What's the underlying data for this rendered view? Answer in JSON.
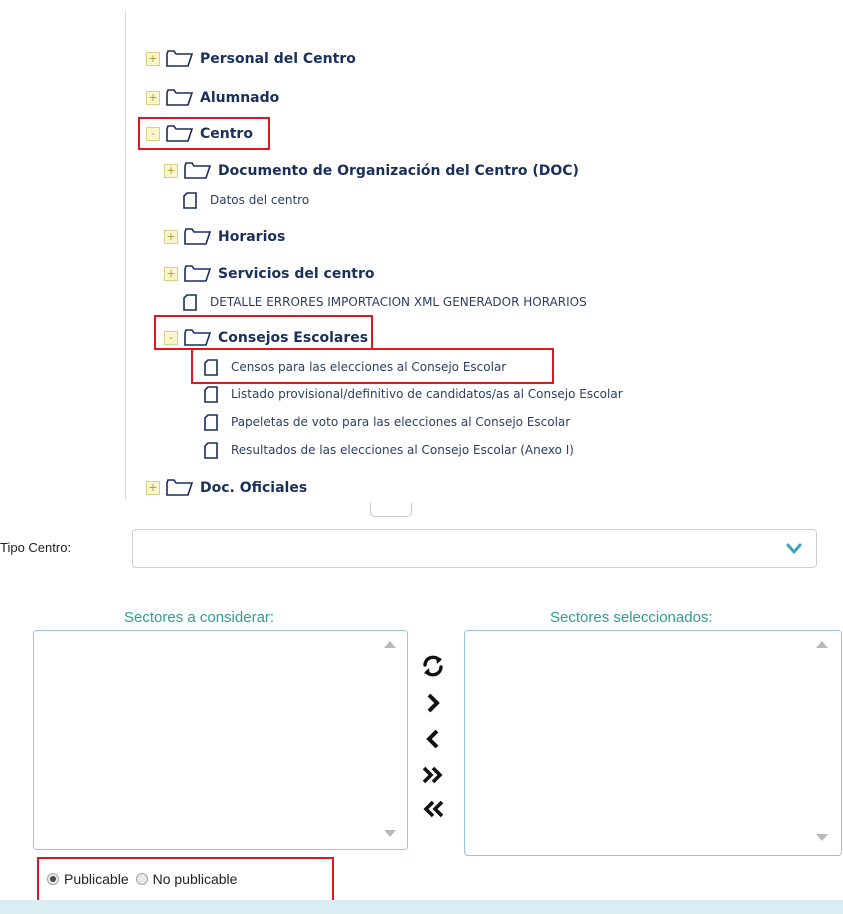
{
  "tree": {
    "folders": [
      {
        "label": "Personal del Centro",
        "toggle": "+"
      },
      {
        "label": "Alumnado",
        "toggle": "+"
      },
      {
        "label": "Centro",
        "toggle": "-"
      },
      {
        "label": "Documento de Organización del Centro (DOC)",
        "toggle": "+"
      },
      {
        "label": "Horarios",
        "toggle": "+"
      },
      {
        "label": "Servicios del centro",
        "toggle": "+"
      },
      {
        "label": "Consejos Escolares",
        "toggle": "-"
      },
      {
        "label": "Doc. Oficiales",
        "toggle": "+"
      }
    ],
    "documents": [
      {
        "label": "Datos del centro"
      },
      {
        "label": "DETALLE ERRORES IMPORTACION XML GENERADOR HORARIOS"
      },
      {
        "label": "Censos para las elecciones al Consejo Escolar"
      },
      {
        "label": "Listado provisional/definitivo de candidatos/as al Consejo Escolar"
      },
      {
        "label": "Papeletas de voto para las elecciones al Consejo Escolar"
      },
      {
        "label": "Resultados de las elecciones al Consejo Escolar (Anexo I)"
      }
    ],
    "icons": {
      "folder": "folder-icon",
      "document": "document-icon"
    }
  },
  "form": {
    "tipo_centro": {
      "label": "Tipo Centro:",
      "value": "",
      "icon": "chevron-down-icon"
    },
    "sectores_considerar": {
      "title": "Sectores a considerar:"
    },
    "sectores_seleccionados": {
      "title": "Sectores seleccionados:"
    },
    "controls": [
      "refresh-icon",
      "move-right-icon",
      "move-left-icon",
      "move-all-right-icon",
      "move-all-left-icon"
    ],
    "visibility": {
      "options": [
        {
          "label": "Publicable",
          "selected": true
        },
        {
          "label": "No publicable",
          "selected": false
        }
      ]
    }
  },
  "colors": {
    "tree_text": "#1b2f5b",
    "highlight_box": "#e0171e",
    "list_title": "#2e9e93",
    "accent_chevron": "#3aa3c5",
    "bottom_bar": "#d9eef2"
  }
}
